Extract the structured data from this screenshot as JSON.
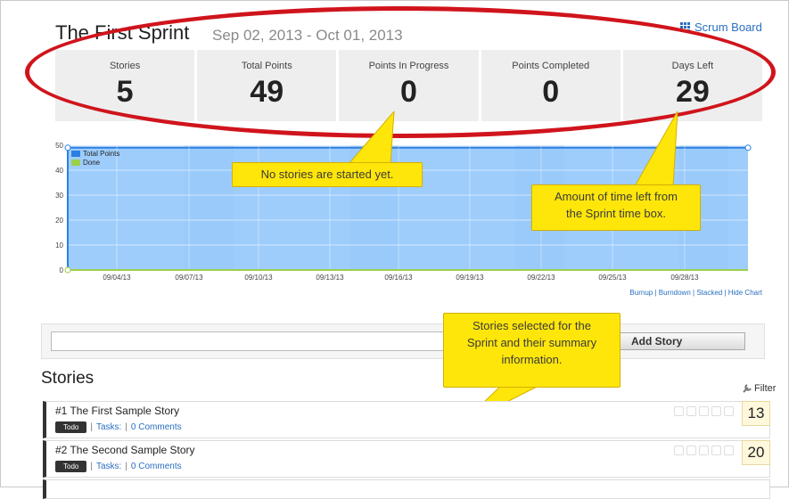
{
  "sprint": {
    "title": "The First Sprint",
    "dates": "Sep 02, 2013 - Oct 01, 2013",
    "scrum_board_label": "Scrum Board"
  },
  "stats": [
    {
      "label": "Stories",
      "value": "5"
    },
    {
      "label": "Total Points",
      "value": "49"
    },
    {
      "label": "Points In Progress",
      "value": "0"
    },
    {
      "label": "Points Completed",
      "value": "0"
    },
    {
      "label": "Days Left",
      "value": "29"
    }
  ],
  "chart_data": {
    "type": "area",
    "x": [
      "09/04/13",
      "09/07/13",
      "09/10/13",
      "09/13/13",
      "09/16/13",
      "09/19/13",
      "09/22/13",
      "09/25/13",
      "09/28/13"
    ],
    "y_ticks": [
      "50",
      "40",
      "30",
      "20",
      "10",
      "0"
    ],
    "ylim": [
      0,
      50
    ],
    "series": [
      {
        "name": "Total Points",
        "values": [
          49,
          49,
          49,
          49,
          49,
          49,
          49,
          49,
          49
        ],
        "color": "#2c7fe0"
      },
      {
        "name": "Done",
        "values": [
          0,
          0,
          0,
          0,
          0,
          0,
          0,
          0,
          0
        ],
        "color": "#9bd14a"
      }
    ],
    "legend": "top-left",
    "grid": true
  },
  "chart_links": [
    "Burnup",
    "Burndown",
    "Stacked",
    "Hide Chart"
  ],
  "callouts": {
    "no_started": "No stories are started yet.",
    "time_left": [
      "Amount of time left from",
      "the Sprint time box."
    ],
    "stories_selected": [
      "Stories selected for the",
      "Sprint and their summary",
      "information."
    ]
  },
  "add_story": {
    "button_label": "Add Story",
    "input_value": ""
  },
  "stories_heading": "Stories",
  "filter_label": "Filter",
  "stories": [
    {
      "title": "#1 The First Sample Story",
      "status": "Todo",
      "tasks": "Tasks:",
      "comments": "0 Comments",
      "points": "13"
    },
    {
      "title": "#2 The Second Sample Story",
      "status": "Todo",
      "tasks": "Tasks:",
      "comments": "0 Comments",
      "points": "20"
    }
  ],
  "colors": {
    "accent": "#2a6fbf",
    "callout": "#ffe60a",
    "annotation": "#d0141c",
    "chart_fill": "#a8d0fa"
  }
}
